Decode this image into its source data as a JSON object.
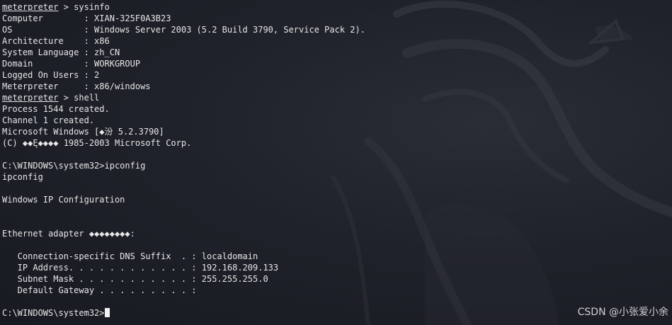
{
  "terminal": {
    "lines": [
      {
        "prompt": "meterpreter",
        "rest": " > sysinfo"
      },
      {
        "rest": "Computer        : XIAN-325F0A3B23"
      },
      {
        "rest": "OS              : Windows Server 2003 (5.2 Build 3790, Service Pack 2)."
      },
      {
        "rest": "Architecture    : x86"
      },
      {
        "rest": "System Language : zh_CN"
      },
      {
        "rest": "Domain          : WORKGROUP"
      },
      {
        "rest": "Logged On Users : 2"
      },
      {
        "rest": "Meterpreter     : x86/windows"
      },
      {
        "prompt": "meterpreter",
        "rest": " > shell"
      },
      {
        "rest": "Process 1544 created."
      },
      {
        "rest": "Channel 1 created."
      },
      {
        "rest": "Microsoft Windows [◆汾 5.2.3790]"
      },
      {
        "rest": "(C) ◆◆Ę◆◆◆◆ 1985-2003 Microsoft Corp."
      },
      {
        "rest": ""
      },
      {
        "rest": "C:\\WINDOWS\\system32>ipconfig"
      },
      {
        "rest": "ipconfig"
      },
      {
        "rest": ""
      },
      {
        "rest": "Windows IP Configuration"
      },
      {
        "rest": ""
      },
      {
        "rest": ""
      },
      {
        "rest": "Ethernet adapter ◆◆◆◆◆◆◆◆:"
      },
      {
        "rest": ""
      },
      {
        "rest": "   Connection-specific DNS Suffix  . : localdomain"
      },
      {
        "rest": "   IP Address. . . . . . . . . . . . : 192.168.209.133"
      },
      {
        "rest": "   Subnet Mask . . . . . . . . . . . : 255.255.255.0"
      },
      {
        "rest": "   Default Gateway . . . . . . . . . :"
      },
      {
        "rest": ""
      },
      {
        "rest": "C:\\WINDOWS\\system32>",
        "cursor": true
      }
    ]
  },
  "watermark": "CSDN @小张爱小余",
  "colors": {
    "background": "#1f222a",
    "text": "#e6e6e6",
    "cursor": "#f2f2f2"
  }
}
